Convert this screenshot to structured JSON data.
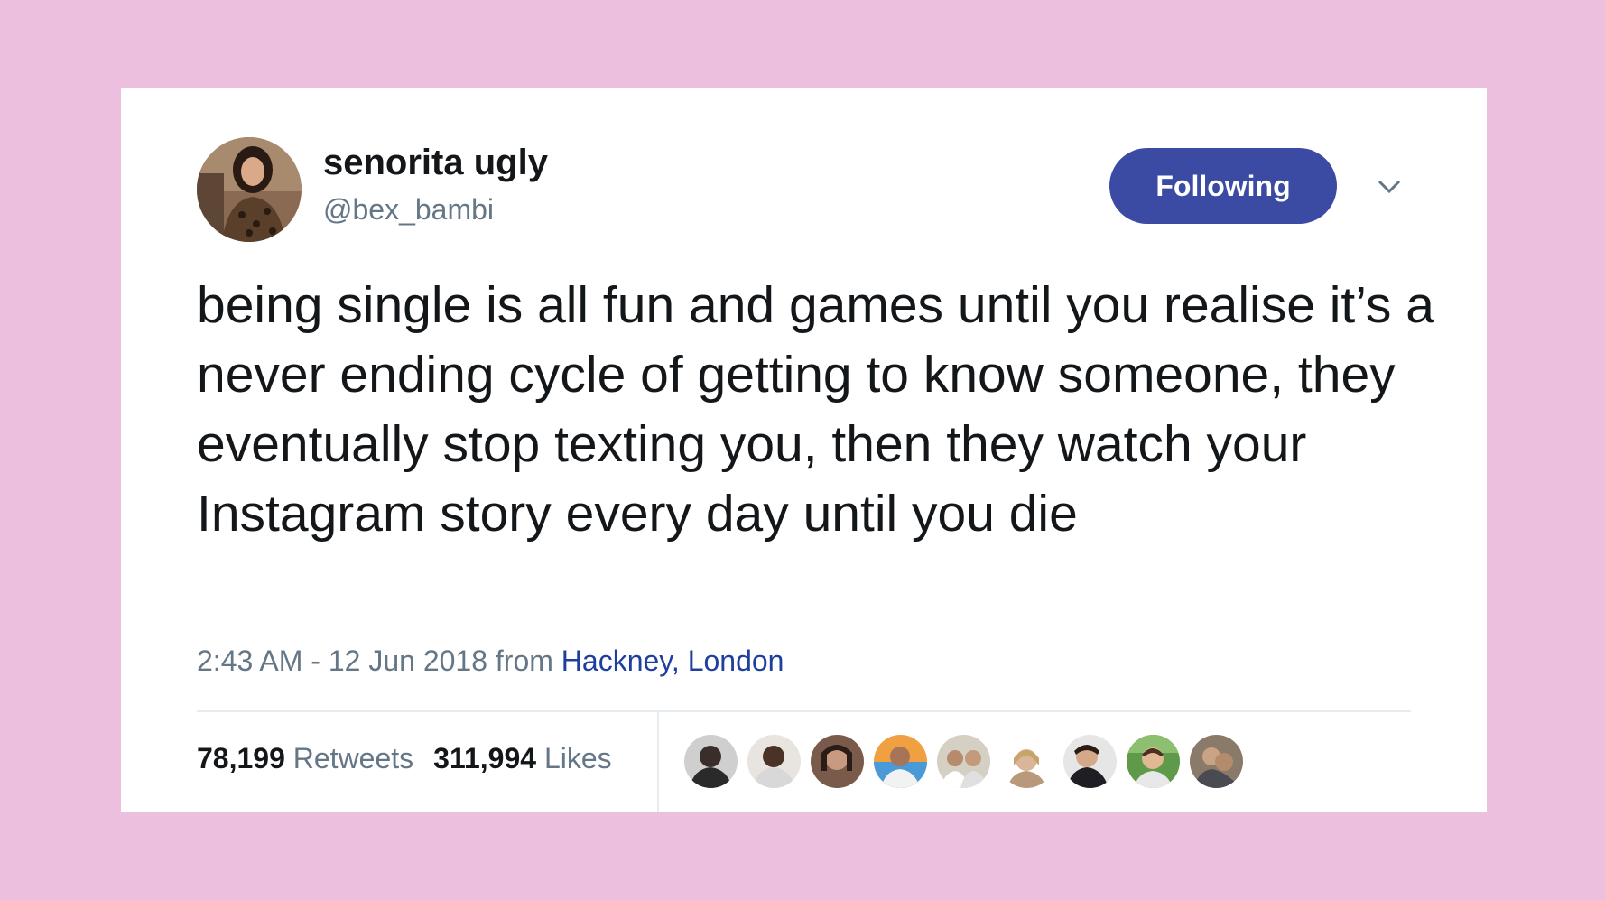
{
  "tweet": {
    "display_name": "senorita ugly",
    "handle": "@bex_bambi",
    "follow_button_label": "Following",
    "text": "being single is all fun and games until you realise it’s a never ending cycle of getting to know someone, they eventually stop texting you, then they watch your Instagram story every day until you die",
    "timestamp": "2:43 AM - 12 Jun 2018",
    "from_label": "from",
    "location": "Hackney, London",
    "retweets_count": "78,199",
    "retweets_label": "Retweets",
    "likes_count": "311,994",
    "likes_label": "Likes"
  },
  "colors": {
    "page_background": "#ebbfdd",
    "card_background": "#ffffff",
    "follow_button": "#3b4aa3",
    "link": "#1f3f9e",
    "secondary_text": "#657786"
  },
  "icons": {
    "menu": "chevron-down-icon"
  }
}
